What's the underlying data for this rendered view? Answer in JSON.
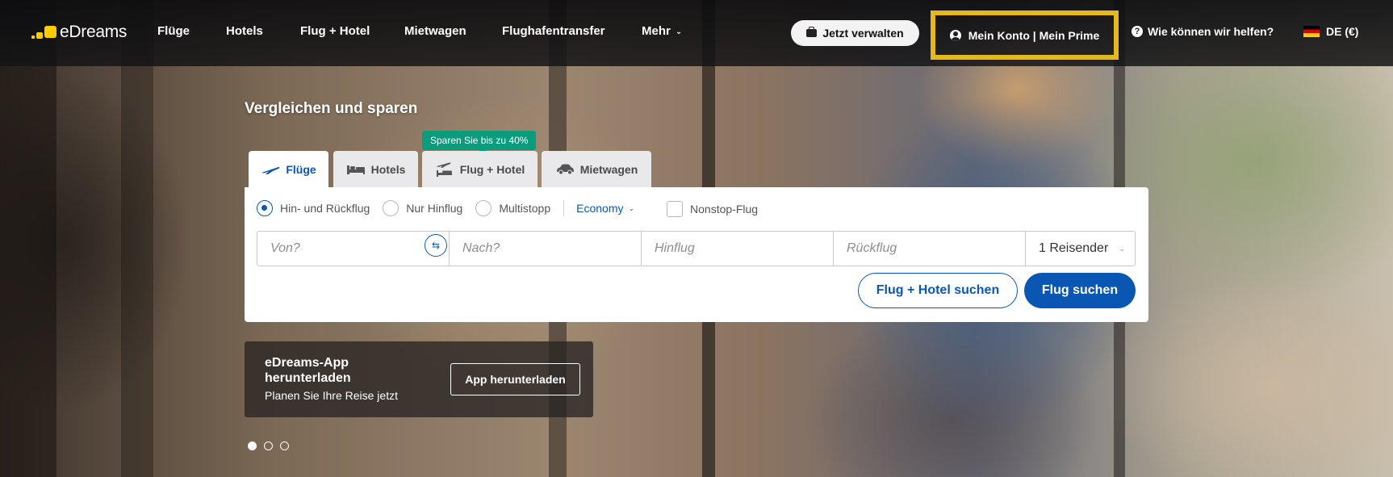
{
  "header": {
    "logo_text": "eDreams",
    "nav": [
      {
        "label": "Flüge"
      },
      {
        "label": "Hotels"
      },
      {
        "label": "Flug + Hotel"
      },
      {
        "label": "Mietwagen"
      },
      {
        "label": "Flughafentransfer"
      },
      {
        "label": "Mehr"
      }
    ],
    "manage_label": "Jetzt verwalten",
    "account_label": "Mein Konto | Mein Prime",
    "help_label": "Wie können wir helfen?",
    "help_icon_glyph": "?",
    "language_label": "DE (€)"
  },
  "hero": {
    "title": "Vergleichen und sparen",
    "promo_badge": "Sparen Sie bis zu 40%"
  },
  "search": {
    "tabs": [
      {
        "label": "Flüge",
        "icon": "plane-icon",
        "active": true
      },
      {
        "label": "Hotels",
        "icon": "bed-icon",
        "active": false
      },
      {
        "label": "Flug + Hotel",
        "icon": "plane-hotel-icon",
        "active": false
      },
      {
        "label": "Mietwagen",
        "icon": "car-icon",
        "active": false
      }
    ],
    "trip_types": [
      {
        "label": "Hin- und Rückflug",
        "selected": true
      },
      {
        "label": "Nur Hinflug",
        "selected": false
      },
      {
        "label": "Multistopp",
        "selected": false
      }
    ],
    "cabin_class": "Economy",
    "nonstop_label": "Nonstop-Flug",
    "nonstop_checked": false,
    "from_placeholder": "Von?",
    "to_placeholder": "Nach?",
    "depart_placeholder": "Hinflug",
    "return_placeholder": "Rückflug",
    "travellers": "1 Reisender",
    "combo_button": "Flug + Hotel suchen",
    "search_button": "Flug suchen"
  },
  "app_banner": {
    "title": "eDreams-App herunterladen",
    "subtitle": "Planen Sie Ihre Reise jetzt",
    "button": "App herunterladen"
  },
  "carousel": {
    "total": 3,
    "active_index": 0
  },
  "colors": {
    "brand_yellow": "#ffcc00",
    "primary_blue": "#0a57b3",
    "promo_green": "#0a9c7d",
    "highlight_border": "#e5b91a"
  }
}
